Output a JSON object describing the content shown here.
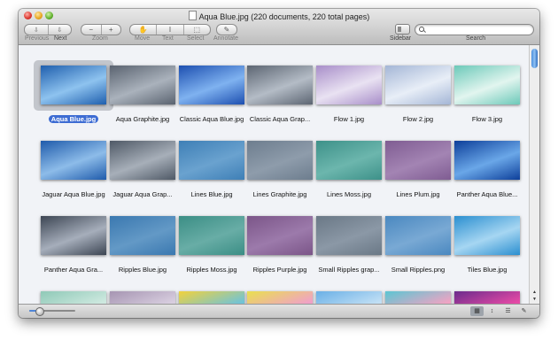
{
  "window": {
    "title": "Aqua Blue.jpg (220 documents, 220 total pages)"
  },
  "toolbar": {
    "previous_label": "Previous",
    "next_label": "Next",
    "zoom_label": "Zoom",
    "zoom_out": "−",
    "zoom_in": "+",
    "move_label": "Move",
    "text_label": "Text",
    "select_label": "Select",
    "annotate_label": "Annotate",
    "sidebar_label": "Sidebar",
    "search_label": "Search",
    "search_value": ""
  },
  "thumbnails": [
    {
      "name": "Aqua Blue.jpg",
      "c1": "#1f5fae",
      "c2": "#8ec3ef",
      "selected": true
    },
    {
      "name": "Aqua Graphite.jpg",
      "c1": "#5a6370",
      "c2": "#aab2bc"
    },
    {
      "name": "Classic Aqua Blue.jpg",
      "c1": "#1d4fb0",
      "c2": "#7fb2f0"
    },
    {
      "name": "Classic Aqua Grap...",
      "c1": "#5c6572",
      "c2": "#b4bcc6"
    },
    {
      "name": "Flow 1.jpg",
      "c1": "#a88ec9",
      "c2": "#e9e2f2"
    },
    {
      "name": "Flow 2.jpg",
      "c1": "#a4b6d6",
      "c2": "#e8eef7"
    },
    {
      "name": "Flow 3.jpg",
      "c1": "#6cc9b9",
      "c2": "#e2f5ef"
    },
    {
      "name": "Jaguar Aqua Blue.jpg",
      "c1": "#1f5bab",
      "c2": "#8dbce9"
    },
    {
      "name": "Jaguar Aqua Grap...",
      "c1": "#4f5966",
      "c2": "#a7afb9"
    },
    {
      "name": "Lines Blue.jpg",
      "c1": "#3e7fb6",
      "c2": "#6aa2cf"
    },
    {
      "name": "Lines Graphite.jpg",
      "c1": "#6d7d8e",
      "c2": "#8e9cab"
    },
    {
      "name": "Lines Moss.jpg",
      "c1": "#3d9189",
      "c2": "#6cb6ad"
    },
    {
      "name": "Lines Plum.jpg",
      "c1": "#7f5c92",
      "c2": "#a384b3"
    },
    {
      "name": "Panther Aqua Blue...",
      "c1": "#0d3f9a",
      "c2": "#6aa7e8"
    },
    {
      "name": "Panther Aqua Gra...",
      "c1": "#3c4553",
      "c2": "#a6aebb"
    },
    {
      "name": "Ripples Blue.jpg",
      "c1": "#3a78b0",
      "c2": "#6399c6"
    },
    {
      "name": "Ripples Moss.jpg",
      "c1": "#3b8e85",
      "c2": "#68ada6"
    },
    {
      "name": "Ripples Purple.jpg",
      "c1": "#7b5588",
      "c2": "#9c7aab"
    },
    {
      "name": "Small Ripples grap...",
      "c1": "#6a7886",
      "c2": "#8b98a6"
    },
    {
      "name": "Small Ripples.png",
      "c1": "#4a88c0",
      "c2": "#79a9d4"
    },
    {
      "name": "Tiles Blue.jpg",
      "c1": "#2b8fd0",
      "c2": "#a6d6f2"
    },
    {
      "name": "",
      "c1": "#8fc9b7",
      "c2": "#cfe9e0"
    },
    {
      "name": "",
      "c1": "#a695b2",
      "c2": "#d9cfe0"
    },
    {
      "name": "",
      "c1": "#f2d23c",
      "c2": "#6fc3d9"
    },
    {
      "name": "",
      "c1": "#e9e04e",
      "c2": "#f0a0c9"
    },
    {
      "name": "",
      "c1": "#6ab0e6",
      "c2": "#c3e0f5"
    },
    {
      "name": "",
      "c1": "#5bc6d3",
      "c2": "#f2a3c3"
    },
    {
      "name": "",
      "c1": "#6b2c8c",
      "c2": "#e84aa6"
    }
  ],
  "zoom_slider": {
    "value": 0.2
  },
  "icons": [
    "previous-arrow-icon",
    "next-arrow-icon",
    "move-hand-icon",
    "text-cursor-icon",
    "select-dotted-icon",
    "annotate-pencil-icon",
    "sidebar-icon",
    "search-icon",
    "grid-view-icon",
    "sort-icon",
    "list-view-icon",
    "edit-icon"
  ]
}
